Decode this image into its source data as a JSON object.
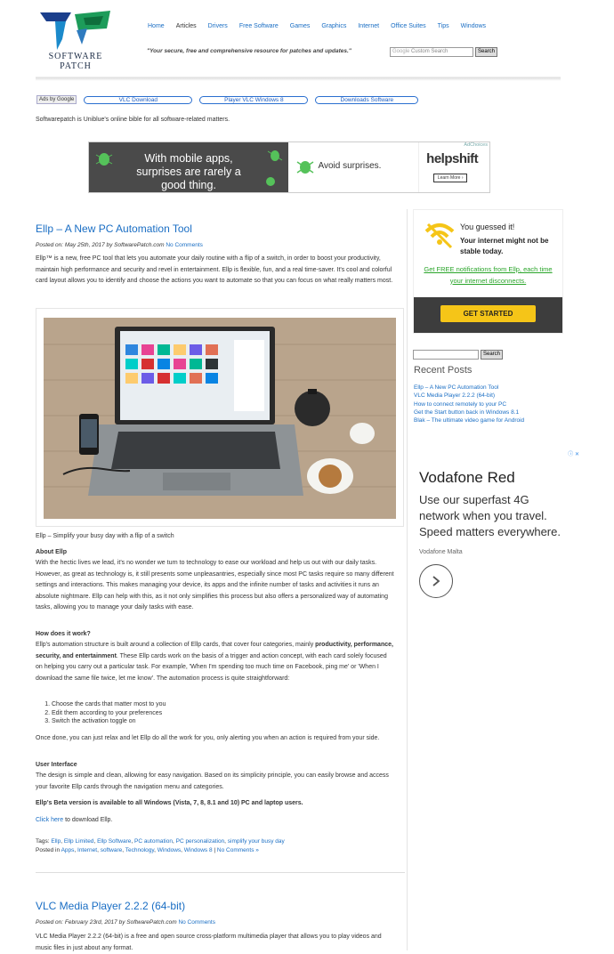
{
  "brand": {
    "line1": "SOFTWARE",
    "line2": "PATCH"
  },
  "nav": [
    "Home",
    "Articles",
    "Drivers",
    "Free Software",
    "Games",
    "Graphics",
    "Internet",
    "Office Suites",
    "Tips",
    "Windows"
  ],
  "tagline": "\"Your secure, free and comprehensive resource for patches and updates.\"",
  "top_search": {
    "placeholder": "Custom Search",
    "google": "Google",
    "button": "Search"
  },
  "ad_links": {
    "ads_by": "Ads by Google",
    "links": [
      "VLC Download",
      "Player VLC Windows 8",
      "Downloads Software"
    ]
  },
  "intro": "Softwarepatch is Uniblue's online bible for all software-related matters.",
  "banner": {
    "left_text": "With mobile apps, surprises are rarely a good thing.",
    "mid_text": "Avoid surprises.",
    "brand": "helpshift",
    "button": "Learn More ›",
    "adchoices": "AdChoices"
  },
  "post1": {
    "title": "Ellp – A New PC Automation Tool",
    "posted_on": "Posted on: May 25th, 2017 by SoftwarePatch.com",
    "comments": "No Comments",
    "p1": "Ellp™ is a new, free PC tool that lets you automate your daily routine with a flip of a switch, in order to boost your productivity, maintain high performance and security and revel in entertainment. Ellp is flexible, fun, and a real time-saver. It's cool and colorful card layout allows you to identify and choose the actions you want to automate so that you can focus on what really matters most.",
    "caption": "Ellp – Simplify your busy day with a flip of a switch",
    "h_about": "About Ellp",
    "p_about": "With the hectic lives we lead, it's no wonder we turn to technology to ease our workload and help us out with our daily tasks. However, as great as technology is, it still presents some unpleasantries, especially since most PC tasks require so many different settings and interactions. This makes managing your device, its apps and the infinite number of tasks and activities it runs an absolute nightmare. Ellp can help with this, as it not only simplifies this process but also offers a personalized way of automating tasks, allowing you to manage your daily tasks with ease.",
    "h_how": "How does it work?",
    "p_how_a": "Ellp's automation structure is built around a collection of Ellp cards, that cover four categories, mainly",
    "p_how_b": "productivity, performance, security, and entertainment",
    "p_how_c": ". These Ellp cards work on the basis of a trigger and action concept, with each card solely focused on helping you carry out a particular task. For example, 'When I'm spending too much time on Facebook, ping me' or 'When I download the same file twice, let me know'. The automation process is quite straightforward:",
    "steps": [
      "Choose the cards that matter most to you",
      "Edit them according to your preferences",
      "Switch the activation toggle on"
    ],
    "p_once": "Once done, you can just relax and let Ellp do all the work for you, only alerting you when an action is required from your side.",
    "h_ui": "User Interface",
    "p_ui": "The design is simple and clean, allowing for easy navigation. Based on its simplicity principle, you can easily browse and access your favorite Ellp cards through the navigation menu and categories.",
    "beta": "Ellp's Beta version is available to all Windows (Vista, 7, 8, 8.1 and 10) PC and laptop users.",
    "click_here": "Click here",
    "download": " to download Ellp.",
    "tags_label": "Tags:",
    "tags": [
      "Ellp",
      "Ellp Limited",
      "Ellp Software",
      "PC automation",
      "PC personalization",
      "simplify your busy day"
    ],
    "posted_in_label": "Posted in",
    "categories": [
      "Apps",
      "Internet",
      "software",
      "Technology",
      "Windows",
      "Windows 8"
    ],
    "no_comments_link": "No Comments »"
  },
  "post2": {
    "title": "VLC Media Player 2.2.2 (64-bit)",
    "posted_on": "Posted on: February 23rd, 2017 by SoftwarePatch.com",
    "comments": "No Comments",
    "p1": "VLC Media Player 2.2.2 (64-bit) is a free and open source cross-platform multimedia player that allows you to play videos and music files in just about any format."
  },
  "sidebar_ad": {
    "h1": "You guessed it!",
    "h2": "Your internet might not be stable today.",
    "link": "Get FREE notifications from Ellp, each time your internet disconnects.",
    "button": "GET STARTED"
  },
  "sidebar_search": {
    "button": "Search"
  },
  "recent": {
    "title": "Recent Posts",
    "items": [
      "Ellp – A New PC Automation Tool",
      "VLC Media Player 2.2.2 (64-bit)",
      "How to connect remotely to your PC",
      "Get the Start button back in Windows 8.1",
      "Blak – The ultimate video game for Android"
    ]
  },
  "vodafone": {
    "title": "Vodafone Red",
    "body": "Use our superfast 4G network when you travel. Speed matters everywhere.",
    "source": "Vodafone Malta"
  },
  "colors": {
    "link": "#1a6ec4",
    "ad_yellow": "#f5c518",
    "ad_green": "#2aa52a"
  }
}
